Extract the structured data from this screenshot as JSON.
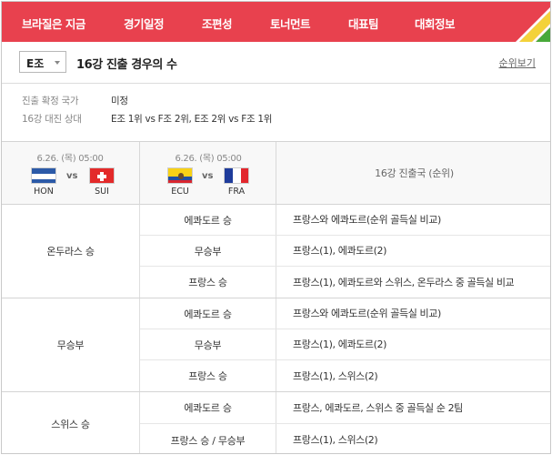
{
  "nav": {
    "items": [
      "브라질은 지금",
      "경기일정",
      "조편성",
      "토너먼트",
      "대표팀",
      "대회정보"
    ]
  },
  "colors": {
    "nav_bg": "#e8414e",
    "stripe_green": "#48a93a",
    "stripe_yellow": "#f3d23a"
  },
  "header": {
    "group_value": "E조",
    "title": "16강 진출 경우의 수",
    "standings_link": "순위보기"
  },
  "info": {
    "confirmed_label": "진출 확정 국가",
    "confirmed_value": "미정",
    "opponent_label": "16강 대진 상대",
    "opponent_value": "E조 1위 vs F조 2위, E조 2위 vs F조 1위"
  },
  "matches": [
    {
      "date": "6.26. (목) 05:00",
      "home": "HON",
      "away": "SUI",
      "vs": "vs",
      "home_flag": "honduras-flag-icon",
      "away_flag": "switzerland-flag-icon"
    },
    {
      "date": "6.26. (목) 05:00",
      "home": "ECU",
      "away": "FRA",
      "vs": "vs",
      "home_flag": "ecuador-flag-icon",
      "away_flag": "france-flag-icon"
    }
  ],
  "qualifier_header": "16강 진출국 (순위)",
  "scenarios": [
    {
      "label": "온두라스 승",
      "rows": [
        {
          "label": "에콰도르 승",
          "result": "프랑스와 에콰도르(순위 골득실 비교)"
        },
        {
          "label": "무승부",
          "result": "프랑스(1), 에콰도르(2)"
        },
        {
          "label": "프랑스 승",
          "result": "프랑스(1), 에콰도르와 스위스, 온두라스 중 골득실 비교"
        }
      ]
    },
    {
      "label": "무승부",
      "rows": [
        {
          "label": "에콰도르 승",
          "result": "프랑스와 에콰도르(순위 골득실 비교)"
        },
        {
          "label": "무승부",
          "result": "프랑스(1), 에콰도르(2)"
        },
        {
          "label": "프랑스 승",
          "result": "프랑스(1), 스위스(2)"
        }
      ]
    },
    {
      "label": "스위스 승",
      "rows": [
        {
          "label": "에콰도르 승",
          "result": "프랑스, 에콰도르, 스위스 중 골득실 순 2팀"
        },
        {
          "label": "프랑스 승 / 무승부",
          "result": "프랑스(1), 스위스(2)"
        }
      ]
    }
  ]
}
